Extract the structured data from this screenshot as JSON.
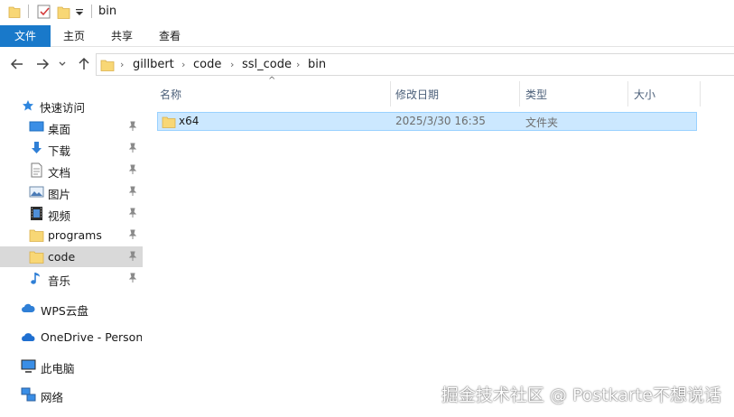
{
  "window": {
    "title": "bin"
  },
  "ribbon": {
    "tabs": [
      "文件",
      "主页",
      "共享",
      "查看"
    ]
  },
  "address": {
    "crumbs": [
      "gillbert",
      "code",
      "ssl_code",
      "bin"
    ]
  },
  "sidebar": {
    "quick_access": "快速访问",
    "items": [
      {
        "label": "桌面",
        "icon": "desktop-icon",
        "pinned": true
      },
      {
        "label": "下载",
        "icon": "download-icon",
        "pinned": true
      },
      {
        "label": "文档",
        "icon": "document-icon",
        "pinned": true
      },
      {
        "label": "图片",
        "icon": "picture-icon",
        "pinned": true
      },
      {
        "label": "视频",
        "icon": "video-icon",
        "pinned": true
      },
      {
        "label": "programs",
        "icon": "folder-icon",
        "pinned": true
      },
      {
        "label": "code",
        "icon": "folder-icon",
        "pinned": true,
        "selected": true
      },
      {
        "label": "音乐",
        "icon": "music-icon",
        "pinned": true
      }
    ],
    "wps": "WPS云盘",
    "onedrive": "OneDrive - Persona",
    "this_pc": "此电脑",
    "network": "网络"
  },
  "columns": [
    "名称",
    "修改日期",
    "类型",
    "大小"
  ],
  "files": [
    {
      "name": "x64",
      "modified": "2025/3/30 16:35",
      "type": "文件夹",
      "size": ""
    }
  ],
  "watermark": "掘金技术社区 @ Postkarte不想说话",
  "colors": {
    "accent": "#1979ca",
    "selection": "#cce8ff",
    "selection_border": "#99d1ff",
    "folder": "#f8d775"
  }
}
